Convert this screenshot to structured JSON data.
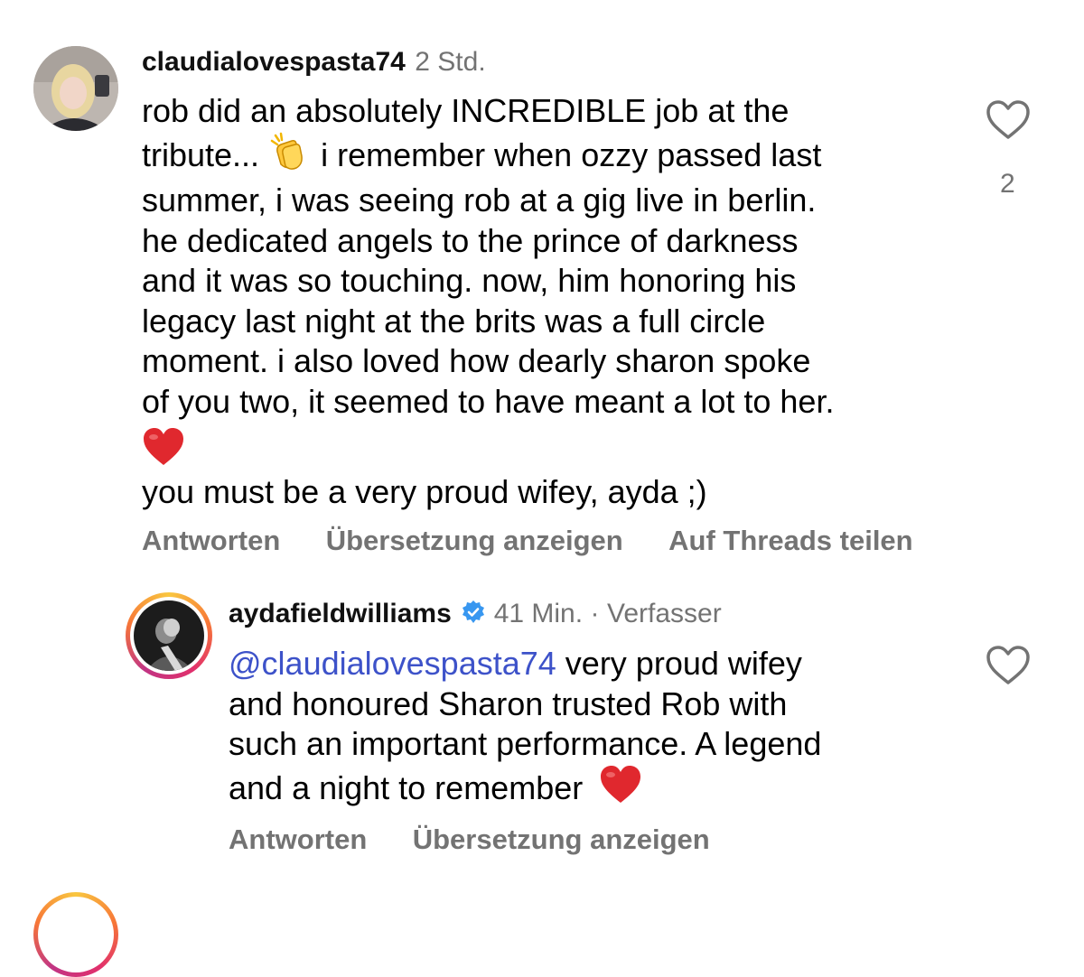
{
  "comments": [
    {
      "username": "claudialovespasta74",
      "time": "2 Std.",
      "lines": [
        "rob did an absolutely INCREDIBLE job at the",
        "tribute...",
        "i remember when ozzy passed last",
        "summer, i was seeing rob at a gig live in berlin.",
        "he dedicated angels to the prince of darkness",
        "and it was so touching. now, him honoring his",
        "legacy last night at the brits was a full circle",
        "moment. i also loved how dearly sharon spoke",
        "of you two, it seemed to have meant a lot to her.",
        "you must be a very proud wifey, ayda ;)"
      ],
      "like_count": "2",
      "actions": {
        "reply": "Antworten",
        "translate": "Übersetzung anzeigen",
        "threads": "Auf Threads teilen"
      }
    },
    {
      "username": "aydafieldwilliams",
      "time": "41 Min.",
      "separator": "·",
      "author_tag": "Verfasser",
      "mention": "@claudialovespasta74",
      "lines": [
        "very proud wifey",
        "and honoured Sharon trusted Rob with",
        "such an important performance. A legend",
        "and a night to remember"
      ],
      "actions": {
        "reply": "Antworten",
        "translate": "Übersetzung anzeigen"
      }
    }
  ],
  "icons": {
    "heart": "heart-outline-icon",
    "clap": "clapping-hands-emoji",
    "red_heart": "red-heart-emoji",
    "verified": "verified-badge-icon"
  },
  "colors": {
    "meta_gray": "#737373",
    "mention_blue": "#3d52c9",
    "verified_blue": "#3897f0",
    "heart_red": "#e0282e"
  }
}
